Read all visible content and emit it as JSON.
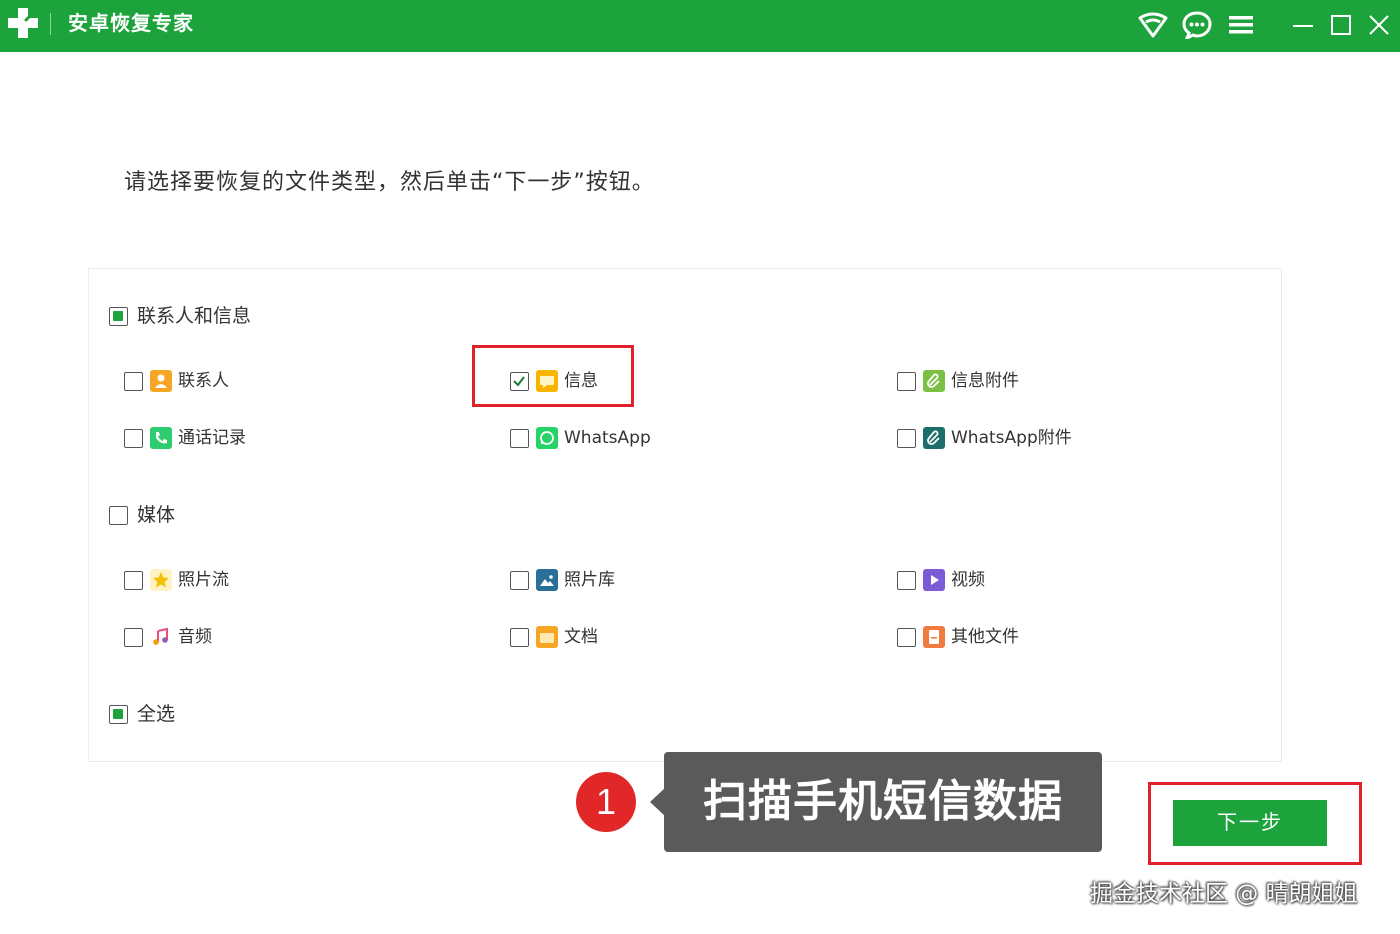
{
  "titlebar": {
    "title": "安卓恢复专家",
    "bg_color": "#1da33c",
    "icons": [
      "wifi-icon",
      "chat-icon",
      "menu-icon",
      "minimize-icon",
      "maximize-icon",
      "close-icon"
    ]
  },
  "instruction": "请选择要恢复的文件类型，然后单击“下一步”按钮。",
  "groups": {
    "contacts_messages": {
      "label": "联系人和信息",
      "state": "partial",
      "items": [
        {
          "label": "联系人",
          "checked": false,
          "icon": "contact-icon",
          "color": "#f5a623"
        },
        {
          "label": "信息",
          "checked": true,
          "icon": "message-icon",
          "color": "#f7b500"
        },
        {
          "label": "信息附件",
          "checked": false,
          "icon": "attachment-icon",
          "color": "#7bc043"
        },
        {
          "label": "通话记录",
          "checked": false,
          "icon": "phone-icon",
          "color": "#2ecc71"
        },
        {
          "label": "WhatsApp",
          "checked": false,
          "icon": "whatsapp-icon",
          "color": "#25d366"
        },
        {
          "label": "WhatsApp附件",
          "checked": false,
          "icon": "whatsapp-attachment-icon",
          "color": "#1d6e6a"
        }
      ]
    },
    "media": {
      "label": "媒体",
      "state": "unchecked",
      "items": [
        {
          "label": "照片流",
          "checked": false,
          "icon": "star-icon",
          "color": "#f5c000"
        },
        {
          "label": "照片库",
          "checked": false,
          "icon": "photo-library-icon",
          "color": "#2a6f97"
        },
        {
          "label": "视频",
          "checked": false,
          "icon": "video-icon",
          "color": "#7b5cd6"
        },
        {
          "label": "音频",
          "checked": false,
          "icon": "music-icon",
          "color": "#e94e77"
        },
        {
          "label": "文档",
          "checked": false,
          "icon": "folder-icon",
          "color": "#f5a623"
        },
        {
          "label": "其他文件",
          "checked": false,
          "icon": "file-icon",
          "color": "#f07b3f"
        }
      ]
    }
  },
  "select_all": {
    "label": "全选",
    "state": "partial"
  },
  "callout": {
    "number": "1",
    "text": "扫描手机短信数据"
  },
  "next_button": {
    "label": "下一步"
  },
  "watermark": "掘金技术社区 @ 晴朗姐姐",
  "colors": {
    "accent": "#1da33c",
    "highlight": "#e0202a",
    "callout_bg": "#5a5a5a",
    "badge": "#e12727"
  }
}
